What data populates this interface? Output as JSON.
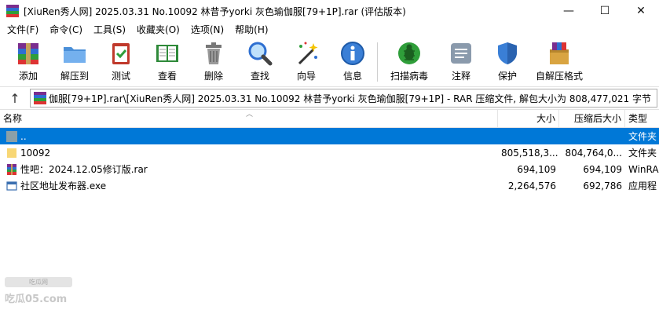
{
  "window": {
    "title": "[XiuRen秀人网] 2025.03.31 No.10092 林昔予yorki 灰色瑜伽服[79+1P].rar (评估版本)",
    "minimize": "—",
    "maximize": "☐",
    "close": "✕"
  },
  "menu": [
    "文件(F)",
    "命令(C)",
    "工具(S)",
    "收藏夹(O)",
    "选项(N)",
    "帮助(H)"
  ],
  "toolbar": {
    "items": [
      {
        "label": "添加",
        "icon": "add-archive-icon"
      },
      {
        "label": "解压到",
        "icon": "extract-to-folder-icon"
      },
      {
        "label": "测试",
        "icon": "test-clipboard-icon"
      },
      {
        "label": "查看",
        "icon": "view-book-icon"
      },
      {
        "label": "删除",
        "icon": "trash-icon"
      },
      {
        "label": "查找",
        "icon": "magnifier-icon"
      },
      {
        "label": "向导",
        "icon": "wizard-wand-icon"
      },
      {
        "label": "信息",
        "icon": "info-icon"
      },
      {
        "label": "扫描病毒",
        "icon": "virus-scan-icon"
      },
      {
        "label": "注释",
        "icon": "comment-icon"
      },
      {
        "label": "保护",
        "icon": "shield-icon"
      },
      {
        "label": "自解压格式",
        "icon": "sfx-archive-icon"
      }
    ]
  },
  "address": {
    "path": "伽服[79+1P].rar\\[XiuRen秀人网] 2025.03.31 No.10092 林昔予yorki 灰色瑜伽服[79+1P] - RAR 压缩文件, 解包大小为 808,477,021 字节"
  },
  "columns": {
    "name": "名称",
    "size": "大小",
    "packed": "压缩后大小",
    "type": "类型"
  },
  "files": [
    {
      "name": "..",
      "size": "",
      "packed": "",
      "type": "文件夹",
      "icon": "parent-folder-icon",
      "selected": true
    },
    {
      "name": "10092",
      "size": "805,518,3...",
      "packed": "804,764,0...",
      "type": "文件夹",
      "icon": "folder-icon",
      "selected": false
    },
    {
      "name": "性吧：2024.12.05修订版.rar",
      "size": "694,109",
      "packed": "694,109",
      "type": "WinRA",
      "icon": "rar-icon",
      "selected": false
    },
    {
      "name": "社区地址发布器.exe",
      "size": "2,264,576",
      "packed": "692,786",
      "type": "应用程",
      "icon": "exe-icon",
      "selected": false
    }
  ],
  "watermark": {
    "badge": "吃瓜网",
    "text": "吃瓜05.com"
  },
  "colors": {
    "selection": "#0078d7",
    "folder": "#f8d775"
  }
}
